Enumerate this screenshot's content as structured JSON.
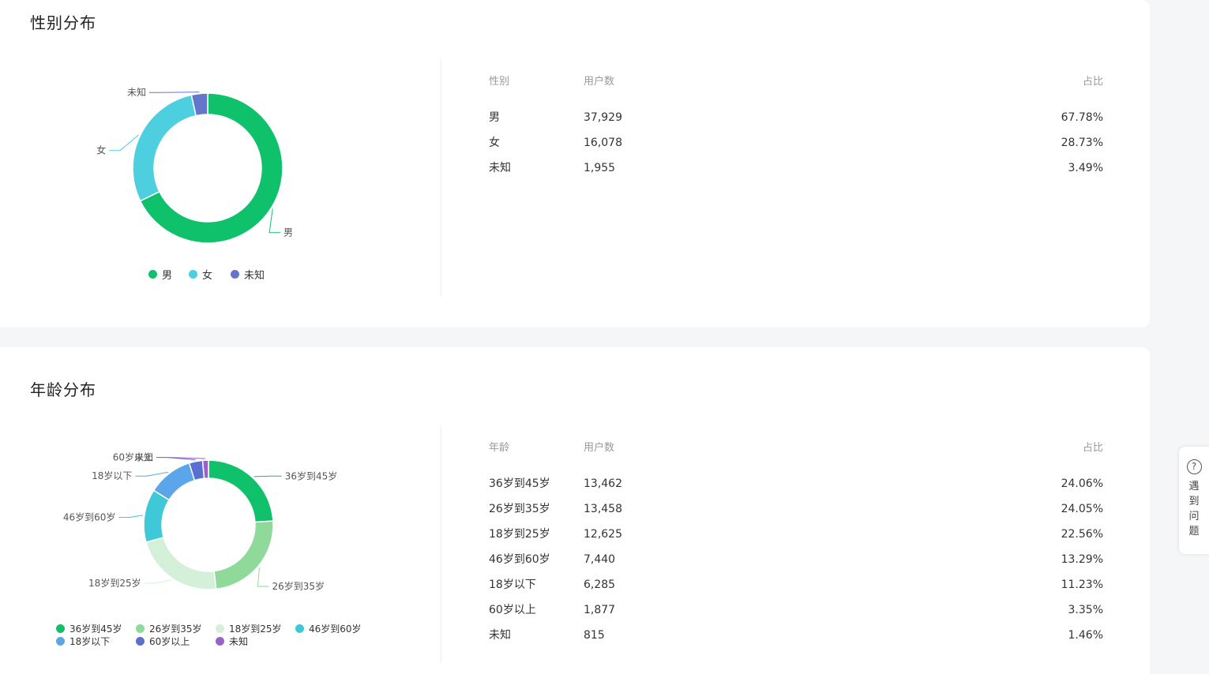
{
  "gender": {
    "title": "性别分布",
    "table": {
      "headers": [
        "性别",
        "用户数",
        "占比"
      ],
      "rows": [
        [
          "男",
          "37,929",
          "67.78%"
        ],
        [
          "女",
          "16,078",
          "28.73%"
        ],
        [
          "未知",
          "1,955",
          "3.49%"
        ]
      ]
    }
  },
  "age": {
    "title": "年龄分布",
    "table": {
      "headers": [
        "年龄",
        "用户数",
        "占比"
      ],
      "rows": [
        [
          "36岁到45岁",
          "13,462",
          "24.06%"
        ],
        [
          "26岁到35岁",
          "13,458",
          "24.05%"
        ],
        [
          "18岁到25岁",
          "12,625",
          "22.56%"
        ],
        [
          "46岁到60岁",
          "7,440",
          "13.29%"
        ],
        [
          "18岁以下",
          "6,285",
          "11.23%"
        ],
        [
          "60岁以上",
          "1,877",
          "3.35%"
        ],
        [
          "未知",
          "815",
          "1.46%"
        ]
      ]
    }
  },
  "help": {
    "label": "遇到问题",
    "icon": "question-circle-icon"
  },
  "chart_data": [
    {
      "type": "pie",
      "title": "性别分布",
      "donut": true,
      "legend_position": "bottom",
      "categories": [
        "男",
        "女",
        "未知"
      ],
      "values": [
        37929,
        16078,
        1955
      ],
      "colors": [
        "#0fc16a",
        "#4ecfe0",
        "#6475cc"
      ]
    },
    {
      "type": "pie",
      "title": "年龄分布",
      "donut": true,
      "legend_position": "bottom",
      "categories": [
        "36岁到45岁",
        "26岁到35岁",
        "18岁到25岁",
        "46岁到60岁",
        "18岁以下",
        "60岁以上",
        "未知"
      ],
      "values": [
        13462,
        13458,
        12625,
        7440,
        6285,
        1877,
        815
      ],
      "colors": [
        "#0fc16a",
        "#8fd99a",
        "#d4f0d8",
        "#3fc8d8",
        "#5ba6ea",
        "#5a6fd0",
        "#9a62c9"
      ]
    }
  ]
}
